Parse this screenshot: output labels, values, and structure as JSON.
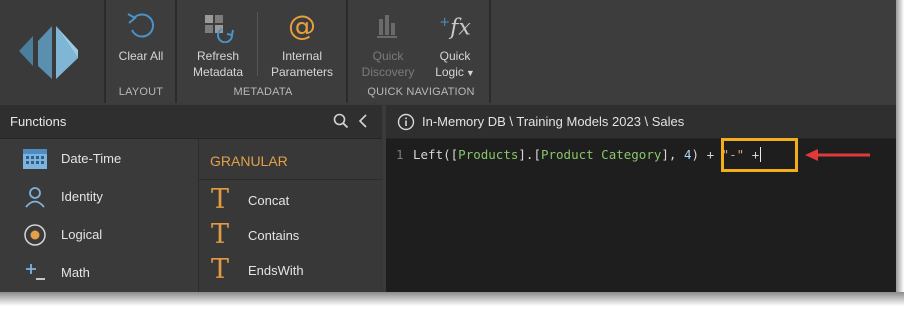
{
  "ribbon": {
    "groups": [
      {
        "label": "LAYOUT",
        "buttons": [
          {
            "label": "Clear All",
            "icon": "undo-circle-icon"
          }
        ]
      },
      {
        "label": "METADATA",
        "buttons": [
          {
            "label": "Refresh\nMetadata",
            "line1": "Refresh",
            "line2": "Metadata",
            "icon": "refresh-metadata-icon"
          },
          {
            "label": "Internal\nParameters",
            "line1": "Internal",
            "line2": "Parameters",
            "icon": "at-sign-icon"
          }
        ]
      },
      {
        "label": "QUICK NAVIGATION",
        "buttons": [
          {
            "line1": "Quick",
            "line2": "Discovery",
            "icon": "quick-discovery-icon",
            "disabled": true
          },
          {
            "line1": "Quick",
            "line2": "Logic",
            "icon": "fx-icon",
            "dropdown": true
          }
        ]
      }
    ]
  },
  "functions_panel": {
    "title": "Functions",
    "categories": [
      {
        "label": "Date-Time",
        "icon": "calendar-icon"
      },
      {
        "label": "Identity",
        "icon": "person-icon"
      },
      {
        "label": "Logical",
        "icon": "radio-circle-icon"
      },
      {
        "label": "Math",
        "icon": "plus-minus-icon"
      }
    ],
    "granular": {
      "title": "GRANULAR",
      "functions": [
        {
          "label": "Concat",
          "icon": "text-T-icon"
        },
        {
          "label": "Contains",
          "icon": "text-T-icon"
        },
        {
          "label": "EndsWith",
          "icon": "text-T-icon"
        }
      ]
    }
  },
  "editor": {
    "path": "In-Memory DB \\ Training Models 2023 \\ Sales",
    "line_number": "1",
    "tokens": {
      "fn": "Left(",
      "b1": "[",
      "id1": "Products",
      "b2": "].[",
      "id2": "Product Category",
      "b3": "], ",
      "num": "4",
      "close": ") ",
      "plus1": "+ ",
      "str": "\"-\"",
      "plus2": " +"
    }
  },
  "colors": {
    "accent_orange": "#f2ae1d",
    "granular_title": "#e2a04a",
    "arrow_red": "#e0393a",
    "ident_green": "#89c46a"
  }
}
